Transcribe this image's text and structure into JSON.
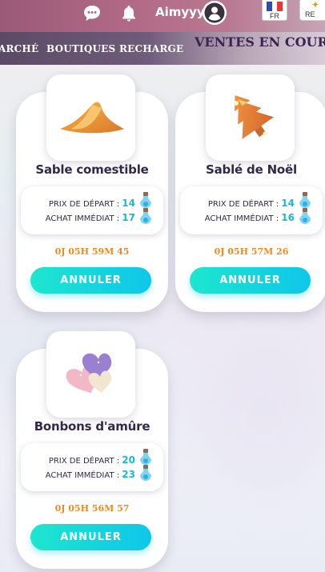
{
  "header": {
    "username": "Aimyyy",
    "language_code": "FR",
    "recharge_partial": "RE",
    "icons": [
      "chat-icon",
      "bell-icon",
      "user-icon"
    ]
  },
  "nav": {
    "items": [
      "ARCHÉ",
      "BOUTIQUES",
      "RECHARGE"
    ],
    "section_title": "VENTES EN COURS"
  },
  "labels": {
    "start_price": "PRIX DE DÉPART :",
    "buy_now": "ACHAT IMMÉDIAT :",
    "cancel": "ANNULER"
  },
  "listings": [
    {
      "name": "Sable comestible",
      "start_price": "14",
      "buy_now": "17",
      "timer": "0J 05H 59M 45",
      "image": "sand-pile-icon"
    },
    {
      "name": "Sablé de Noël",
      "start_price": "14",
      "buy_now": "16",
      "timer": "0J 05H 57M 26",
      "image": "christmas-tree-cookie-icon"
    },
    {
      "name": "Bonbons d'amûre",
      "start_price": "20",
      "buy_now": "23",
      "timer": "0J 05H 56M 57",
      "image": "heart-candies-icon"
    }
  ],
  "colors": {
    "accent_price": "#1bb7d6",
    "timer": "#f08a1c",
    "button": "#13d3de",
    "title_text": "#34284a"
  }
}
